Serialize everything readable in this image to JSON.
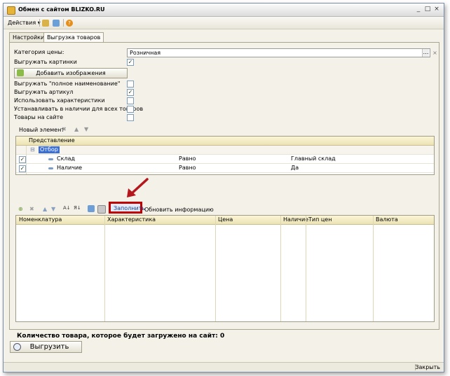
{
  "window": {
    "title": "Обмен с сайтом BLIZKO.RU"
  },
  "toolbar": {
    "actions_label": "Действия"
  },
  "tabs": [
    {
      "label": "Настройки"
    },
    {
      "label": "Выгрузка товаров"
    }
  ],
  "form": {
    "price_category_label": "Категория цены:",
    "price_category_value": "Розничная",
    "export_images_label": "Выгружать картинки",
    "export_images_checked": true,
    "add_images_button": "Добавить изображения",
    "export_full_name_label": "Выгружать \"полное наименование\"",
    "export_full_name_checked": false,
    "export_article_label": "Выгружать артикул",
    "export_article_checked": true,
    "use_characteristics_label": "Использовать характеристики",
    "use_characteristics_checked": false,
    "set_in_stock_label": "Устанавливать в наличии для всех товаров",
    "set_in_stock_checked": false,
    "goods_on_site_label": "Товары на сайте",
    "goods_on_site_checked": false
  },
  "filter_toolbar": {
    "new_element_label": "Новый элемент"
  },
  "filter_grid": {
    "header": "Представление",
    "group_label": "Отбор",
    "rows": [
      {
        "checked": true,
        "name": "Склад",
        "condition": "Равно",
        "value": "Главный склад"
      },
      {
        "checked": true,
        "name": "Наличие",
        "condition": "Равно",
        "value": "Да"
      }
    ]
  },
  "goods_toolbar": {
    "fill_label": "Заполнить",
    "update_label": "Обновить информацию"
  },
  "goods_grid": {
    "columns": [
      "Номенклатура",
      "Характеристика",
      "Цена",
      "Наличие",
      "Тип цен",
      "Валюта"
    ]
  },
  "summary_text": "Количество товара, которое будет загружено на сайт: 0",
  "upload_button": "Выгрузить",
  "status": {
    "close_label": "Закрыть"
  },
  "colors": {
    "highlight": "#c00000",
    "arrow": "#b5161c",
    "selection": "#3b6fd4"
  }
}
